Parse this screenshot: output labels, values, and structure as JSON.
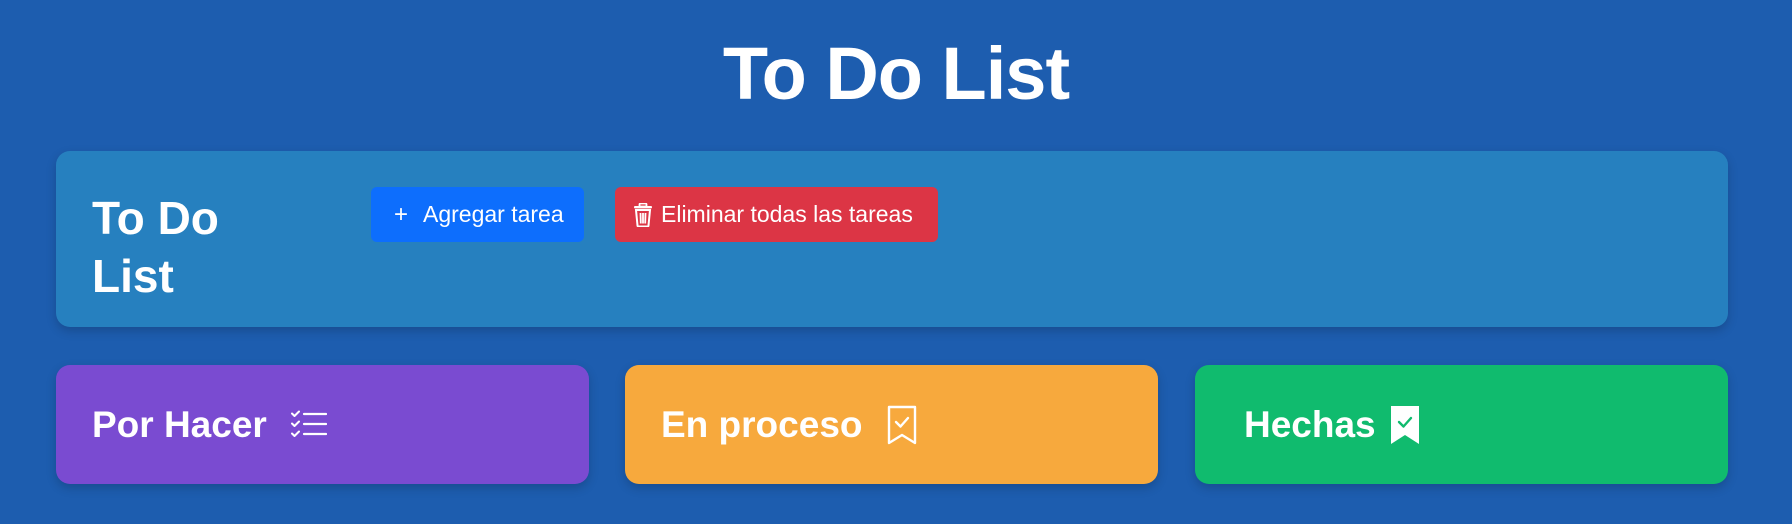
{
  "page": {
    "title": "To Do List"
  },
  "toolbar": {
    "title": "To Do List",
    "add_button": {
      "label": "Agregar tarea",
      "icon": "plus-icon",
      "color": "#0d6efd"
    },
    "delete_all_button": {
      "label": "Eliminar todas las tareas",
      "icon": "trash-icon",
      "color": "#dc3545"
    }
  },
  "columns": [
    {
      "title": "Por Hacer",
      "icon": "checklist-icon",
      "color": "#7a4bd1"
    },
    {
      "title": "En proceso",
      "icon": "bookmark-check-outline-icon",
      "color": "#f7a93d"
    },
    {
      "title": "Hechas",
      "icon": "bookmark-check-filled-icon",
      "color": "#10bb6e"
    }
  ],
  "colors": {
    "background": "#1d5daf",
    "toolbar_card": "#2680bf",
    "text": "#ffffff"
  }
}
